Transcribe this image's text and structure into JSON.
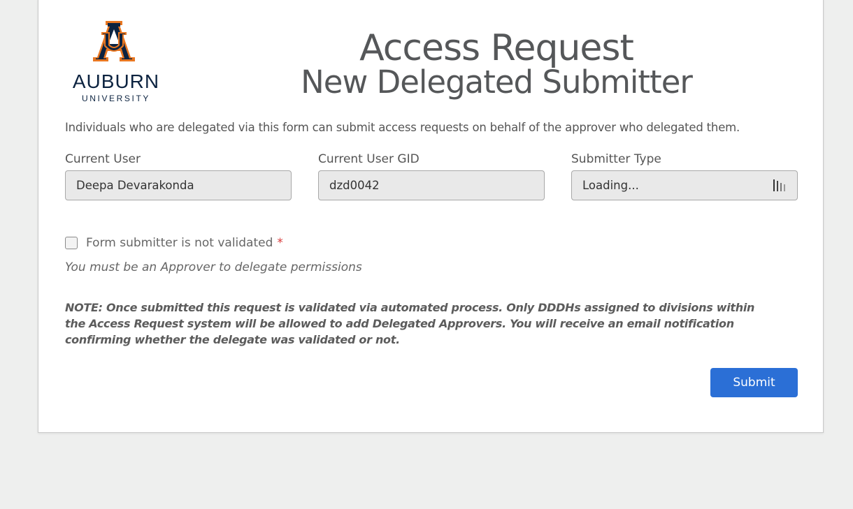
{
  "header": {
    "logo_word": "AUBURN",
    "logo_sub": "UNIVERSITY",
    "title_line1": "Access Request",
    "title_line2": "New Delegated Submitter"
  },
  "intro": "Individuals who are delegated via this form can submit access requests on behalf of the approver who delegated them.",
  "fields": {
    "current_user": {
      "label": "Current User",
      "value": "Deepa Devarakonda"
    },
    "current_user_gid": {
      "label": "Current User GID",
      "value": "dzd0042"
    },
    "submitter_type": {
      "label": "Submitter Type",
      "value": "Loading..."
    }
  },
  "validation": {
    "checkbox_label": "Form submitter is not validated",
    "required_mark": "*",
    "hint": "You must be an Approver to delegate permissions"
  },
  "note": "NOTE: Once submitted this request is validated via automated process. Only DDDHs assigned to divisions within the Access Request system will be allowed to add Delegated Approvers. You will receive an email notification confirming whether the delegate was validated or not.",
  "actions": {
    "submit_label": "Submit"
  },
  "colors": {
    "brand_navy": "#0c2340",
    "brand_orange": "#e87722",
    "button_blue": "#2b6fd6",
    "required_red": "#d83b3b"
  }
}
